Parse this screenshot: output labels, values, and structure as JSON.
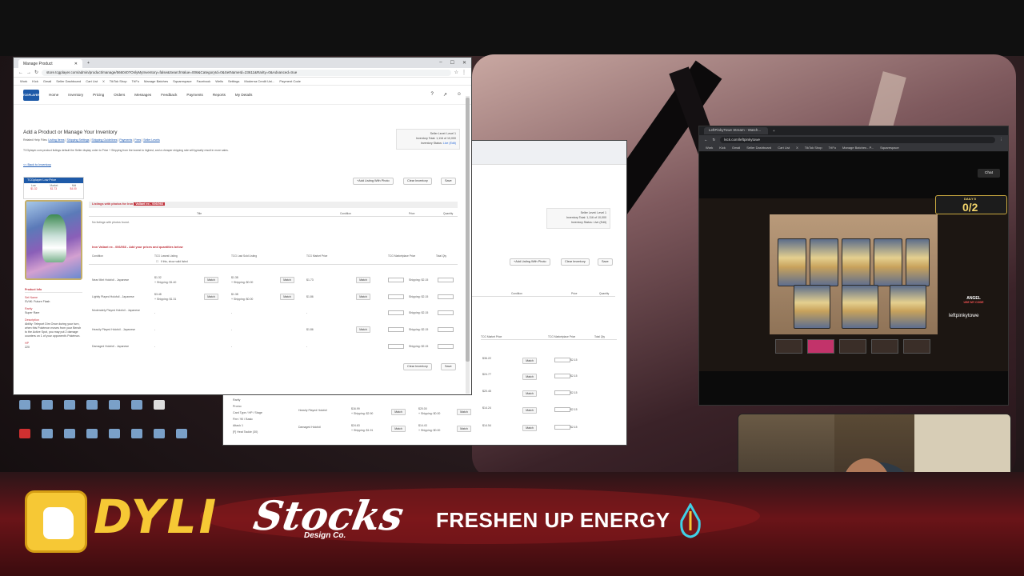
{
  "main_window": {
    "tab_title": "Manage Product",
    "url": "store.tcgplayer.com/admin/product/manage/566040?OnlyMyInventory=false&SearchValue=006&CategoryId=0&SetNameId=23611&Rarity=0&Advanced=true",
    "bookmarks": [
      "Work",
      "Kick",
      "Gmail",
      "Seller Dashboard",
      "Cart List",
      "X",
      "TikTok Shop",
      "TrIFo",
      "Manage Batches",
      "Squarespace",
      "Facebook",
      "Wells",
      "Settings",
      "Moderna Credit Uni...",
      "Payment Code"
    ],
    "nav": [
      "Home",
      "Inventory",
      "Pricing",
      "Orders",
      "Messages",
      "Feedback",
      "Payments",
      "Reports",
      "My Details"
    ],
    "logo": "TCGPLAYER",
    "page_title": "Add a Product or Manage Your Inventory",
    "helper_prefix": "Related Help Files:",
    "helper_links": [
      "Listing Items",
      "Shipping Settings",
      "Shipping Guidelines",
      "Payments",
      "Fees",
      "Seller Levels"
    ],
    "note": "TCGplayer.com product listings default the Seller display order to Price + Shipping from the lowest to highest, and a cheaper shipping rate will typically result in more sales.",
    "seller_level": "Seller Level:  Level 1",
    "inventory_total": "Inventory Total:  1,116 of 10,000",
    "inventory_status": "Inventory Status:",
    "inventory_status_value": "Live (Edit)",
    "back_link": "<< Back to Inventory",
    "add_listing_btn": "+Add Listing With Photo",
    "clear_inventory_btn": "Clear Inventory",
    "save_btn": "Save",
    "price_box": {
      "title": "TCGplayer Low Price",
      "labels": [
        "Low",
        "Market",
        "Mid"
      ],
      "values": [
        "$1.32",
        "$1.73",
        "$4.00"
      ]
    },
    "product_info": {
      "header": "Product Info",
      "set_label": "Set Name",
      "set_value": "SV4K: Future Flash",
      "rarity_label": "Rarity",
      "rarity_value": "Super Rare",
      "desc_label": "Description",
      "desc_value": "Ability: Teleport Dim Once during your turn, when this Pokémon moves from your Bench to the Active Spot, you may put 2 damage counters on 1 of your opponent's Pokémon.",
      "hp_label": "HP",
      "hp_value": "220"
    },
    "photo_section": {
      "title": "Listings with photos for Iron",
      "title_highlight": "Valiant ex - 006/066",
      "columns": [
        "Title",
        "Condition",
        "Price",
        "Quantity"
      ],
      "empty": "No listings with photos found."
    },
    "price_section": {
      "title": "Iron Valiant ex - 006/066 - Add your prices and quantities below",
      "columns": [
        "Condition",
        "TCG Lowest Listing",
        "TCG Last Sold Listing",
        "TCG Market Price",
        "TCG Marketplace Price",
        "Total Qty"
      ],
      "direct_only": "If this, show valid listed",
      "rows": [
        {
          "condition": "Near Mint Holofoil - Japanese",
          "low": "$1.32",
          "low_ship": "+ Shipping: $1.40",
          "last": "$1.38",
          "last_ship": "+ Shipping: $0.00",
          "market": "$1.73",
          "shipping": "Shipping: $2.15"
        },
        {
          "condition": "Lightly Played Holofoil - Japanese",
          "low": "$3.48",
          "low_ship": "+ Shipping: $1.31",
          "last": "$1.38",
          "last_ship": "+ Shipping: $0.00",
          "market": "$1.86",
          "shipping": "Shipping: $2.15"
        },
        {
          "condition": "Moderately Played Holofoil - Japanese",
          "low": "-",
          "low_ship": "",
          "last": "-",
          "last_ship": "",
          "market": "-",
          "shipping": "Shipping: $2.15"
        },
        {
          "condition": "Heavily Played Holofoil - Japanese",
          "low": "-",
          "low_ship": "",
          "last": "-",
          "last_ship": "",
          "market": "$1.86",
          "shipping": "Shipping: $2.15"
        },
        {
          "condition": "Damaged Holofoil - Japanese",
          "low": "-",
          "low_ship": "",
          "last": "-",
          "last_ship": "",
          "market": "-",
          "shipping": "Shipping: $2.15"
        }
      ],
      "match_label": "Match"
    }
  },
  "back_window": {
    "seller_level": "Seller Level:  Level 1",
    "inventory_total": "Inventory Total:  1,116 of 10,000",
    "inventory_status": "Inventory Status:  Live (Edit)",
    "add_listing_btn": "+Add Listing With Photo",
    "clear_inventory_btn": "Clear Inventory",
    "save_btn": "Save",
    "columns": [
      "Condition",
      "Price",
      "Quantity"
    ],
    "price_cols": [
      "TCG Market Price",
      "TCG Marketplace Price",
      "Total Qty"
    ],
    "rows": [
      {
        "market": "$36.22",
        "ship": "$2.15"
      },
      {
        "market": "$24.77",
        "ship": "$2.15"
      },
      {
        "market": "$20.45",
        "ship": "$2.15"
      },
      {
        "market": "$14.24",
        "ship": "$2.15"
      },
      {
        "market": "$14.54",
        "ship": "$2.15"
      }
    ],
    "lower_rows": [
      {
        "label": "Heavily Played Holofoil",
        "a": "$16.99",
        "a_ship": "+ Shipping: $2.90",
        "b": "$20.00",
        "b_ship": "+ Shipping: $0.00"
      },
      {
        "label": "Damaged Holofoil",
        "a": "$24.63",
        "a_ship": "+ Shipping: $1.91",
        "b": "$14.43",
        "b_ship": "+ Shipping: $0.00"
      }
    ],
    "side_labels": [
      "Rarity",
      "Promo",
      "Card Type / HP / Stage",
      "Fire / 90 / Basic",
      "Attack 1",
      "[F] Heat Tackle (30)"
    ],
    "match_label": "Match"
  },
  "kick_window": {
    "tab_title": "LeftPinkyTowe Stream - Watch...",
    "url": "kick.com/leftpinkytowe",
    "bookmarks": [
      "Work",
      "Kick",
      "Gmail",
      "Seller Dashboard",
      "Cart List",
      "X",
      "TikTok Shop",
      "TrIFo",
      "Manage Batches - P...",
      "Squarespace"
    ],
    "chat_btn": "Chat",
    "daily_label": "DAILY 5",
    "daily_value": "0/2",
    "angel_name": "ANGEL",
    "angel_sub": "USE MY CODE",
    "handle": "leftpinkytowe"
  },
  "sponsors": {
    "dyli": "DYLI",
    "stocks": "Stocks",
    "stocks_sub": "Design Co.",
    "fresh": "FRESHEN UP ENERGY"
  },
  "colors": {
    "tcg_blue": "#1e5aa8",
    "tcg_red": "#c0323c",
    "dyli_yellow": "#f6c835",
    "fresh_cyan": "#3fd0e6"
  }
}
